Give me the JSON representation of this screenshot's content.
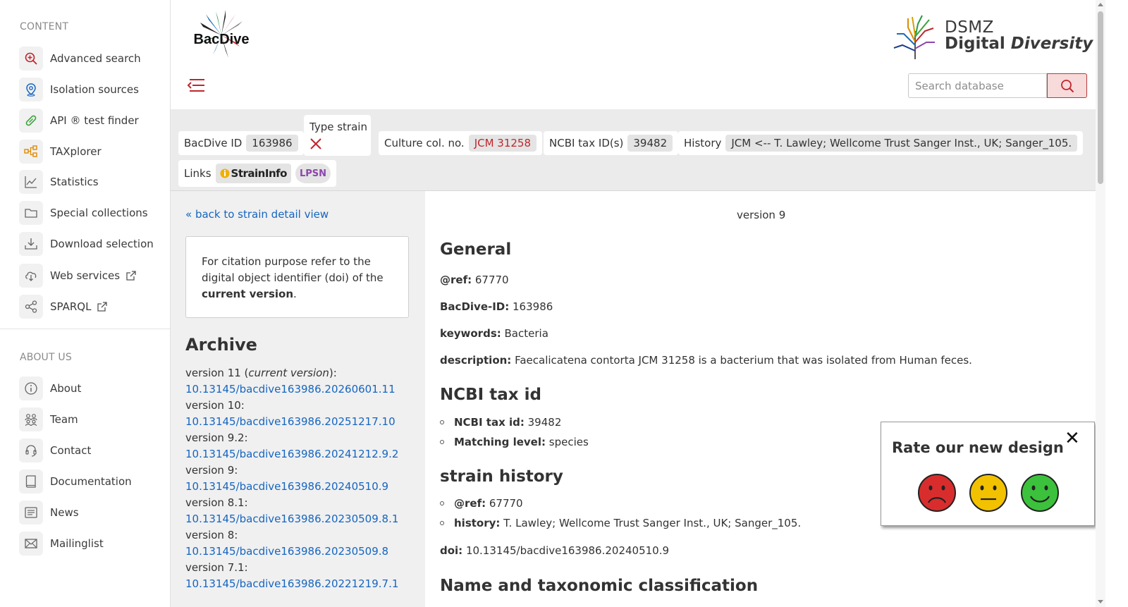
{
  "sidebar": {
    "content_heading": "CONTENT",
    "content_items": [
      {
        "label": "Advanced search",
        "icon": "search-plus-icon"
      },
      {
        "label": "Isolation sources",
        "icon": "location-pin-icon"
      },
      {
        "label": "API ® test finder",
        "icon": "pill-icon"
      },
      {
        "label": "TAXplorer",
        "icon": "hierarchy-icon"
      },
      {
        "label": "Statistics",
        "icon": "line-chart-icon"
      },
      {
        "label": "Special collections",
        "icon": "folder-icon"
      },
      {
        "label": "Download selection",
        "icon": "download-icon"
      },
      {
        "label": "Web services",
        "icon": "cloud-download-icon"
      },
      {
        "label": "SPARQL",
        "icon": "share-nodes-icon"
      }
    ],
    "about_heading": "ABOUT US",
    "about_items": [
      {
        "label": "About",
        "icon": "info-icon"
      },
      {
        "label": "Team",
        "icon": "team-icon"
      },
      {
        "label": "Contact",
        "icon": "headset-icon"
      },
      {
        "label": "Documentation",
        "icon": "book-icon"
      },
      {
        "label": "News",
        "icon": "newspaper-icon"
      },
      {
        "label": "Mailinglist",
        "icon": "envelope-icon"
      }
    ]
  },
  "header": {
    "logo_text": "BacDive",
    "dsmz_line1": "DSMZ",
    "dsmz_line2a": "Digital ",
    "dsmz_line2b": "Diversity",
    "search_placeholder": "Search database"
  },
  "infobar": {
    "bacdive_id_label": "BacDive ID",
    "bacdive_id_value": "163986",
    "type_strain_label": "Type strain",
    "culture_label": "Culture col. no.",
    "culture_value": "JCM 31258",
    "ncbi_label": "NCBI tax ID(s)",
    "ncbi_value": "39482",
    "history_label": "History",
    "history_value": "JCM <-- T. Lawley; Wellcome Trust Sanger Inst., UK; Sanger_105.",
    "links_label": "Links",
    "straininfo_label": "StrainInfo",
    "lpsn_label": "LPSN"
  },
  "left": {
    "back_link": "« back to strain detail view",
    "citation_pre": "For citation purpose refer to the digital object identifier (doi) of the ",
    "citation_bold": "current version",
    "citation_post": ".",
    "archive_title": "Archive",
    "archive": [
      {
        "label": "version 11 (current version):",
        "doi": "10.13145/bacdive163986.20260601.11"
      },
      {
        "label": "version 10:",
        "doi": "10.13145/bacdive163986.20251217.10"
      },
      {
        "label": "version 9.2:",
        "doi": "10.13145/bacdive163986.20241212.9.2"
      },
      {
        "label": "version 9:",
        "doi": "10.13145/bacdive163986.20240510.9"
      },
      {
        "label": "version 8.1:",
        "doi": "10.13145/bacdive163986.20230509.8.1"
      },
      {
        "label": "version 8:",
        "doi": "10.13145/bacdive163986.20230509.8"
      },
      {
        "label": "version 7.1:",
        "doi": "10.13145/bacdive163986.20221219.7.1"
      }
    ]
  },
  "main": {
    "version": "version 9",
    "general_title": "General",
    "ref_key": "@ref:",
    "ref_val": " 67770",
    "bacdive_id_key": "BacDive-ID:",
    "bacdive_id_val": " 163986",
    "keywords_key": "keywords:",
    "keywords_val": " Bacteria",
    "description_key": "description:",
    "description_val": " Faecalicatena contorta JCM 31258 is a bacterium that was isolated from Human feces.",
    "ncbi_title": "NCBI tax id",
    "ncbi_id_key": "NCBI tax id:",
    "ncbi_id_val": " 39482",
    "matching_key": "Matching level:",
    "matching_val": " species",
    "history_title": "strain history",
    "hist_ref_key": "@ref:",
    "hist_ref_val": " 67770",
    "hist_key": "history:",
    "hist_val": " T. Lawley; Wellcome Trust Sanger Inst., UK; Sanger_105.",
    "doi_key": "doi:",
    "doi_val": " 10.13145/bacdive163986.20240510.9",
    "taxonomy_title": "Name and taxonomic classification"
  },
  "rating": {
    "title": "Rate our new design",
    "close": "✕",
    "faces": [
      "sad-face-icon",
      "neutral-face-icon",
      "happy-face-icon"
    ]
  },
  "colors": {
    "accent_red": "#c0262d",
    "link_blue": "#1565c0",
    "sad": "#d92d2d",
    "neutral": "#f2c200",
    "happy": "#3cc13c"
  }
}
